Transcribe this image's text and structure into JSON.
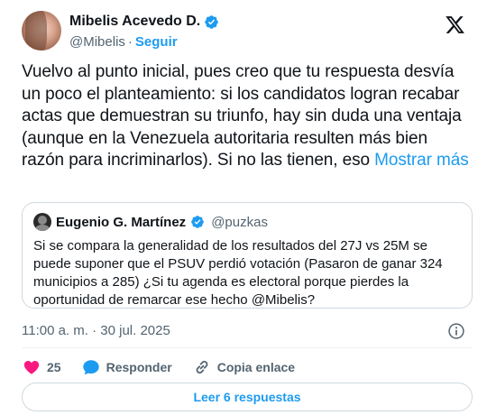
{
  "author": {
    "display_name": "Mibelis Acevedo D.",
    "handle": "@Mibelis",
    "separator": "·",
    "follow_label": "Seguir"
  },
  "tweet": {
    "text": "Vuelvo al punto inicial, pues creo que tu respuesta desvía un poco el planteamiento: si los candidatos logran recabar actas que demuestran su triunfo, hay sin duda una ventaja (aunque en la Venezuela autoritaria resulten más bien razón para incriminarlos). Si no las tienen, eso ",
    "show_more_label": "Mostrar más"
  },
  "quoted": {
    "display_name": "Eugenio G. Martínez",
    "handle": "@puzkas",
    "text": "Si se compara la generalidad de los resultados del 27J vs 25M se puede suponer que el PSUV perdió votación (Pasaron de ganar 324 municipios a 285) ¿Si tu agenda es electoral porque pierdes la oportunidad de remarcar ese hecho @Mibelis?"
  },
  "timestamp": "11:00 a. m. · 30 jul. 2025",
  "actions": {
    "like_count": "25",
    "reply_label": "Responder",
    "copy_link_label": "Copia enlace"
  },
  "read_replies_label": "Leer 6 respuestas",
  "colors": {
    "accent": "#1d9bf0",
    "like": "#f91880",
    "muted": "#536471",
    "border": "#cfd9de"
  },
  "icons": [
    "verified-badge-icon",
    "x-logo-icon",
    "info-icon",
    "heart-icon",
    "reply-bubble-icon",
    "link-icon"
  ]
}
